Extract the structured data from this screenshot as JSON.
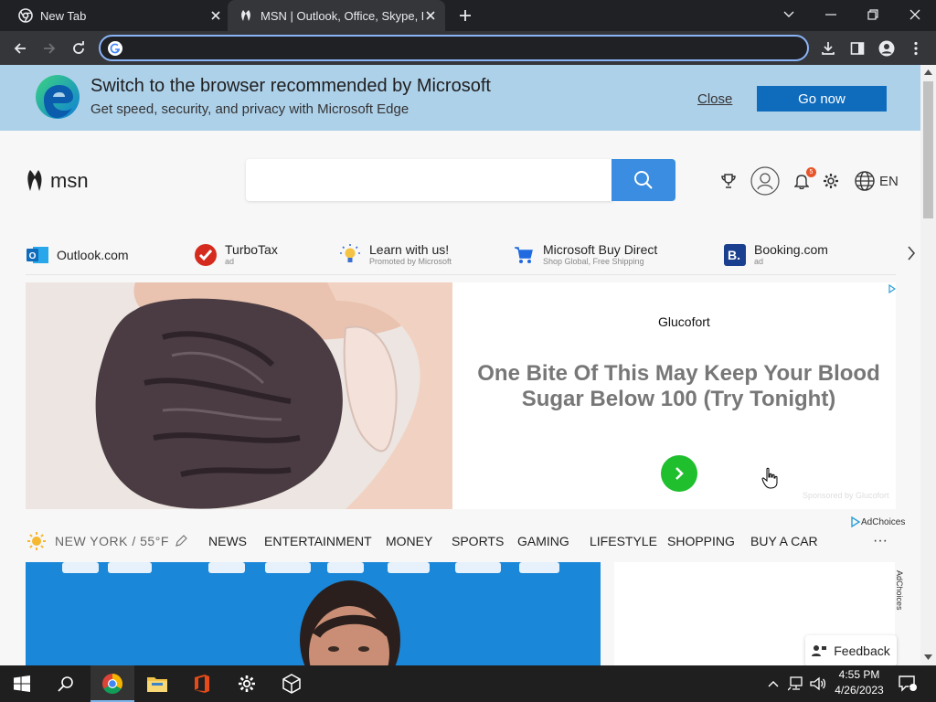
{
  "browser": {
    "tabs": [
      {
        "title": "New Tab"
      },
      {
        "title": "MSN | Outlook, Office, Skype, Bing"
      }
    ],
    "address_value": "",
    "address_placeholder": ""
  },
  "banner": {
    "headline": "Switch to the browser recommended by Microsoft",
    "subtext": "Get speed, security, and privacy with Microsoft Edge",
    "close_label": "Close",
    "go_label": "Go now"
  },
  "header": {
    "logo_text": "msn",
    "search_placeholder": "",
    "notification_count": "5",
    "language": "EN"
  },
  "quick_links": [
    {
      "title": "Outlook.com",
      "subtitle": ""
    },
    {
      "title": "TurboTax",
      "subtitle": "ad"
    },
    {
      "title": "Learn with us!",
      "subtitle": "Promoted by Microsoft"
    },
    {
      "title": "Microsoft Buy Direct",
      "subtitle": "Shop Global, Free Shipping"
    },
    {
      "title": "Booking.com",
      "subtitle": "ad"
    }
  ],
  "ad": {
    "brand": "Glucofort",
    "headline": "One Bite Of This May Keep Your Blood Sugar Below 100 (Try Tonight)",
    "sponsor": "Sponsored by Glucofort",
    "adchoices": "AdChoices"
  },
  "nav": {
    "weather": "NEW YORK / 55°F",
    "items": [
      "NEWS",
      "ENTERTAINMENT",
      "MONEY",
      "SPORTS",
      "GAMING",
      "LIFESTYLE",
      "SHOPPING",
      "BUY A CAR"
    ],
    "more": "···"
  },
  "side_adchoices": "AdChoices",
  "feedback_label": "Feedback",
  "taskbar": {
    "time": "4:55 PM",
    "date": "4/26/2023",
    "notifications": "1"
  },
  "colors": {
    "banner_bg": "#aed1ea",
    "go_button": "#0f6cbd",
    "search_button": "#3a8de0",
    "ad_arrow": "#1fbf2e",
    "tab_active": "#35363a",
    "omnibox_focus": "#8ab4f8"
  }
}
